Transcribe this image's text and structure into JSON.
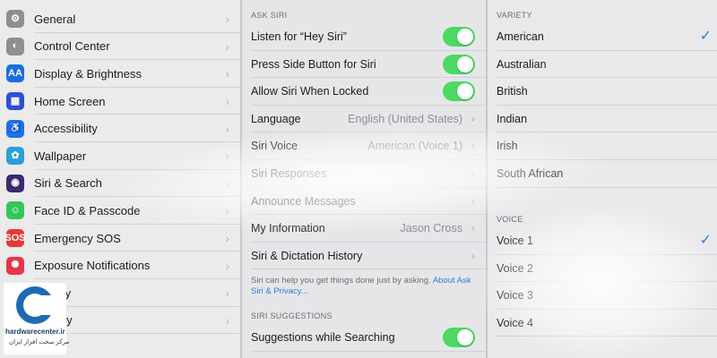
{
  "settings": {
    "items": [
      {
        "label": "General",
        "icon": "gear-icon",
        "color": "#8e8e93",
        "glyph": "⚙"
      },
      {
        "label": "Control Center",
        "icon": "toggles-icon",
        "color": "#8e8e93",
        "glyph": "◐"
      },
      {
        "label": "Display & Brightness",
        "icon": "display-icon",
        "color": "#1a6ee0",
        "glyph": "AA"
      },
      {
        "label": "Home Screen",
        "icon": "home-screen-icon",
        "color": "#2d4fd6",
        "glyph": "▦"
      },
      {
        "label": "Accessibility",
        "icon": "accessibility-icon",
        "color": "#1a73e8",
        "glyph": "♿"
      },
      {
        "label": "Wallpaper",
        "icon": "wallpaper-icon",
        "color": "#2aa0d8",
        "glyph": "✿"
      },
      {
        "label": "Siri & Search",
        "icon": "siri-icon",
        "color": "#3b2a6e",
        "glyph": "◉"
      },
      {
        "label": "Face ID & Passcode",
        "icon": "face-id-icon",
        "color": "#34c759",
        "glyph": "☺"
      },
      {
        "label": "Emergency SOS",
        "icon": "sos-icon",
        "color": "#e53935",
        "glyph": "SOS"
      },
      {
        "label": "Exposure Notifications",
        "icon": "exposure-icon",
        "color": "#e8354a",
        "glyph": "✺"
      },
      {
        "label": "Battery",
        "icon": "battery-icon",
        "color": "#34c759",
        "glyph": "▭"
      },
      {
        "label": "Privacy",
        "icon": "privacy-icon",
        "color": "#1a73e8",
        "glyph": "✋"
      }
    ]
  },
  "siri": {
    "ask_header": "ASK SIRI",
    "rows": [
      {
        "label": "Listen for “Hey Siri”",
        "type": "toggle",
        "on": true
      },
      {
        "label": "Press Side Button for Siri",
        "type": "toggle",
        "on": true
      },
      {
        "label": "Allow Siri When Locked",
        "type": "toggle",
        "on": true
      },
      {
        "label": "Language",
        "type": "value",
        "value": "English (United States)"
      },
      {
        "label": "Siri Voice",
        "type": "value",
        "value": "American (Voice 1)"
      },
      {
        "label": "Siri Responses",
        "type": "nav",
        "value": ""
      },
      {
        "label": "Announce Messages",
        "type": "nav",
        "value": ""
      },
      {
        "label": "My Information",
        "type": "value",
        "value": "Jason Cross"
      },
      {
        "label": "Siri & Dictation History",
        "type": "nav",
        "value": ""
      }
    ],
    "footnote": "Siri can help you get things done just by asking.",
    "footnote_link": "About Ask Siri & Privacy...",
    "suggestions_header": "SIRI SUGGESTIONS",
    "suggestion_rows": [
      {
        "label": "Suggestions while Searching",
        "type": "toggle",
        "on": true
      }
    ]
  },
  "voice": {
    "variety_header": "VARIETY",
    "varieties": [
      {
        "label": "American",
        "checked": true
      },
      {
        "label": "Australian",
        "checked": false
      },
      {
        "label": "British",
        "checked": false
      },
      {
        "label": "Indian",
        "checked": false
      },
      {
        "label": "Irish",
        "checked": false
      },
      {
        "label": "South African",
        "checked": false
      }
    ],
    "voice_header": "VOICE",
    "voices": [
      {
        "label": "Voice 1",
        "checked": true
      },
      {
        "label": "Voice 2",
        "checked": false
      },
      {
        "label": "Voice 3",
        "checked": false
      },
      {
        "label": "Voice 4",
        "checked": false
      }
    ]
  },
  "watermark": {
    "name": "hardwarecenter.ir",
    "sub": "مرکز سخت افزار ایران"
  },
  "colors": {
    "accent": "#2f7bd6",
    "toggle_on": "#4cd964"
  }
}
